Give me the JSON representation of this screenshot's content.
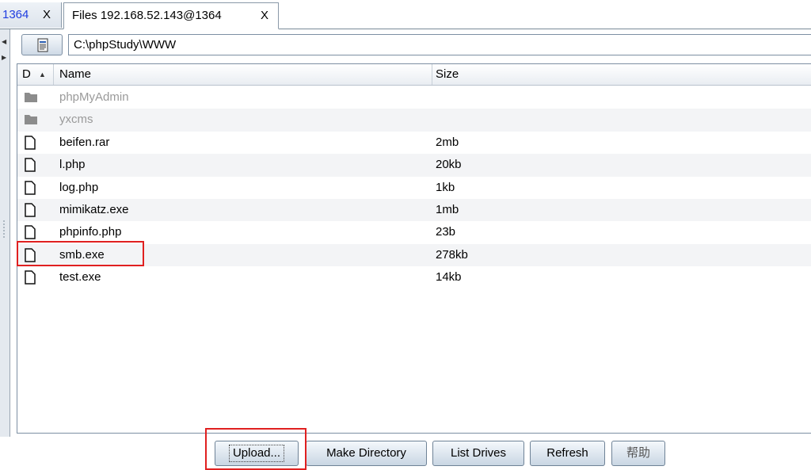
{
  "tabs": [
    {
      "label": "1364",
      "close": "X"
    },
    {
      "label": "Files 192.168.52.143@1364",
      "close": "X"
    }
  ],
  "path": {
    "value": "C:\\phpStudy\\WWW"
  },
  "table": {
    "columns": {
      "d": "D",
      "name": "Name",
      "size": "Size"
    },
    "rows": [
      {
        "type": "dir",
        "name": "phpMyAdmin",
        "size": ""
      },
      {
        "type": "dir",
        "name": "yxcms",
        "size": ""
      },
      {
        "type": "file",
        "name": "beifen.rar",
        "size": "2mb"
      },
      {
        "type": "file",
        "name": "l.php",
        "size": "20kb"
      },
      {
        "type": "file",
        "name": "log.php",
        "size": "1kb"
      },
      {
        "type": "file",
        "name": "mimikatz.exe",
        "size": "1mb"
      },
      {
        "type": "file",
        "name": "phpinfo.php",
        "size": "23b"
      },
      {
        "type": "file",
        "name": "smb.exe",
        "size": "278kb"
      },
      {
        "type": "file",
        "name": "test.exe",
        "size": "14kb"
      }
    ]
  },
  "buttons": {
    "upload": "Upload...",
    "make_directory": "Make Directory",
    "list_drives": "List Drives",
    "refresh": "Refresh",
    "help": "帮助"
  },
  "icons": {
    "folder": "folder-icon",
    "file": "file-icon",
    "path_button": "document-icon"
  },
  "colors": {
    "highlight": "#e02020",
    "active_tab_link": "#1f3de0",
    "dir_text": "#9a9a9a"
  }
}
